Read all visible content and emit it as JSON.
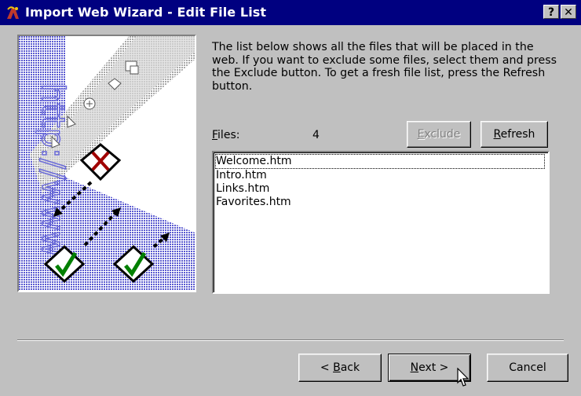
{
  "window": {
    "title": "Import Web Wizard - Edit File List",
    "help_glyph": "?",
    "close_glyph": "✕"
  },
  "art": {
    "vertical_text": "http://www"
  },
  "description": "The list below shows all the files that will be placed in the web. If you want to exclude some files, select them and press the Exclude button. To get a fresh file list, press the Refresh button.",
  "files": {
    "label_accel": "F",
    "label_rest": "iles:",
    "count": "4",
    "items": [
      "Welcome.htm",
      "Intro.htm",
      "Links.htm",
      "Favorites.htm"
    ]
  },
  "buttons": {
    "exclude_accel": "E",
    "exclude_rest": "xclude",
    "refresh_accel": "R",
    "refresh_rest": "efresh",
    "back_prefix": "< ",
    "back_accel": "B",
    "back_rest": "ack",
    "next_accel": "N",
    "next_rest": "ext >",
    "cancel": "Cancel"
  },
  "colors": {
    "titlebar": "#000080",
    "face": "#c0c0c0",
    "art_blue": "#6b6bd6",
    "check_green": "#008000",
    "x_red": "#a00000"
  },
  "icons": [
    "wizard-app-icon",
    "help-icon",
    "close-icon",
    "check-icon",
    "x-mark-icon",
    "arrow-icon",
    "mouse-cursor-icon"
  ]
}
